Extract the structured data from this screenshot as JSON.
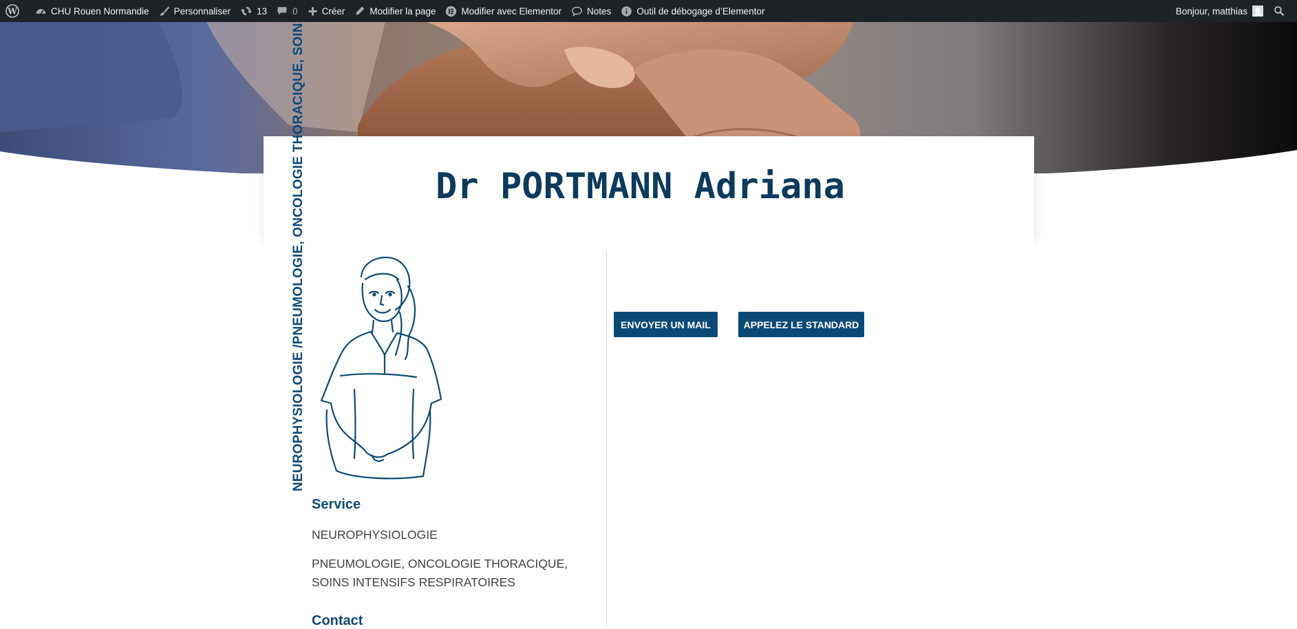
{
  "adminbar": {
    "site_name": "CHU Rouen Normandie",
    "customize": "Personnaliser",
    "updates_count": "13",
    "comments_count": "0",
    "create": "Créer",
    "edit_page": "Modifier la page",
    "edit_elementor": "Modifier avec Elementor",
    "notes": "Notes",
    "debug": "Outil de débogage d’Elementor",
    "greeting": "Bonjour, matthias"
  },
  "page": {
    "title": "Dr PORTMANN Adriana",
    "vertical_services": "NEUROPHYSIOLOGIE /PNEUMOLOGIE, ONCOLOGIE THORACIQUE, SOINS INTENSIFS RESPIRATOIRES"
  },
  "service": {
    "heading": "Service",
    "items": [
      "NEUROPHYSIOLOGIE",
      "PNEUMOLOGIE, ONCOLOGIE THORACIQUE, SOINS INTENSIFS RESPIRATOIRES"
    ]
  },
  "contact": {
    "heading": "Contact"
  },
  "buttons": {
    "mail": "ENVOYER UN MAIL",
    "standard": "APPELEZ LE STANDARD"
  },
  "colors": {
    "brand": "#0c4a76",
    "title": "#0c3a5c",
    "adminbar": "#1d2327"
  },
  "icons": [
    "wordpress-icon",
    "dashboard-icon",
    "brush-icon",
    "updates-icon",
    "comment-icon",
    "plus-icon",
    "pencil-icon",
    "elementor-icon",
    "notes-icon",
    "info-icon",
    "search-icon"
  ]
}
